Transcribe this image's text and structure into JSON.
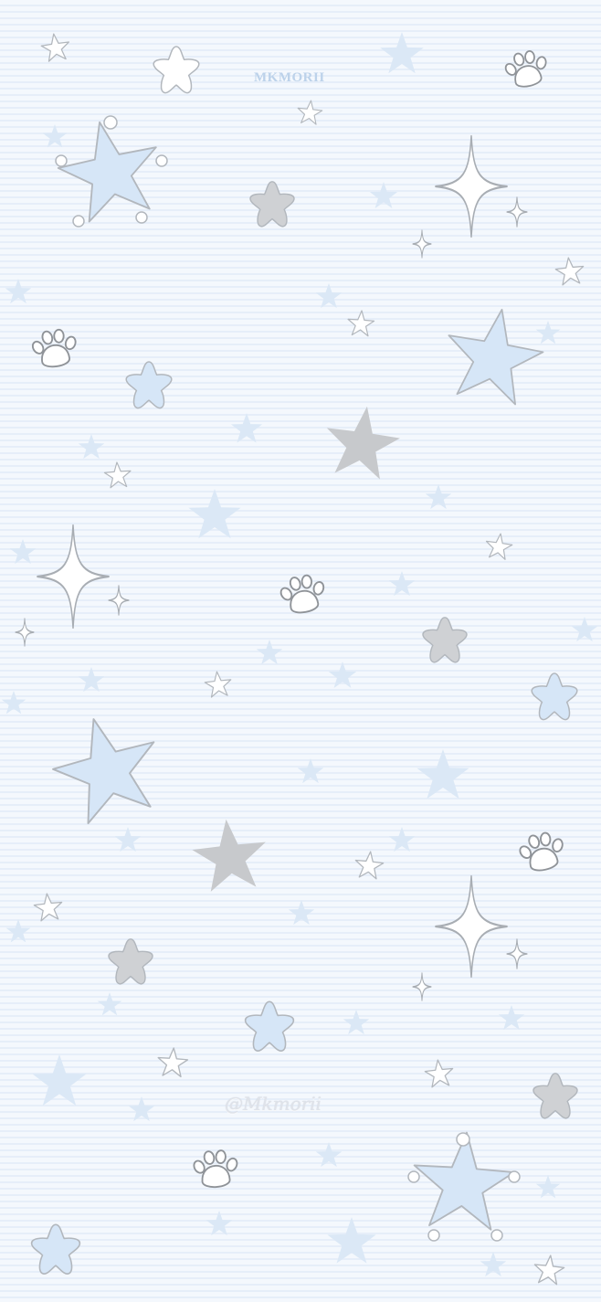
{
  "wallpaper": {
    "watermark": "MKMORII",
    "signature": "@Mkmorii"
  },
  "colors": {
    "background": "#eef5fc",
    "stripe": "#e6eef9",
    "blue_star": "#d6e6f7",
    "grey_star": "#c7c9cc",
    "white_star": "#ffffff",
    "outline": "#b2b7bd",
    "faint_star": "#dbe8f6",
    "watermark": "#bcd2ea"
  },
  "icons": [
    "star-icon",
    "rounded-star-icon",
    "sparkle-icon",
    "paw-print-icon"
  ]
}
